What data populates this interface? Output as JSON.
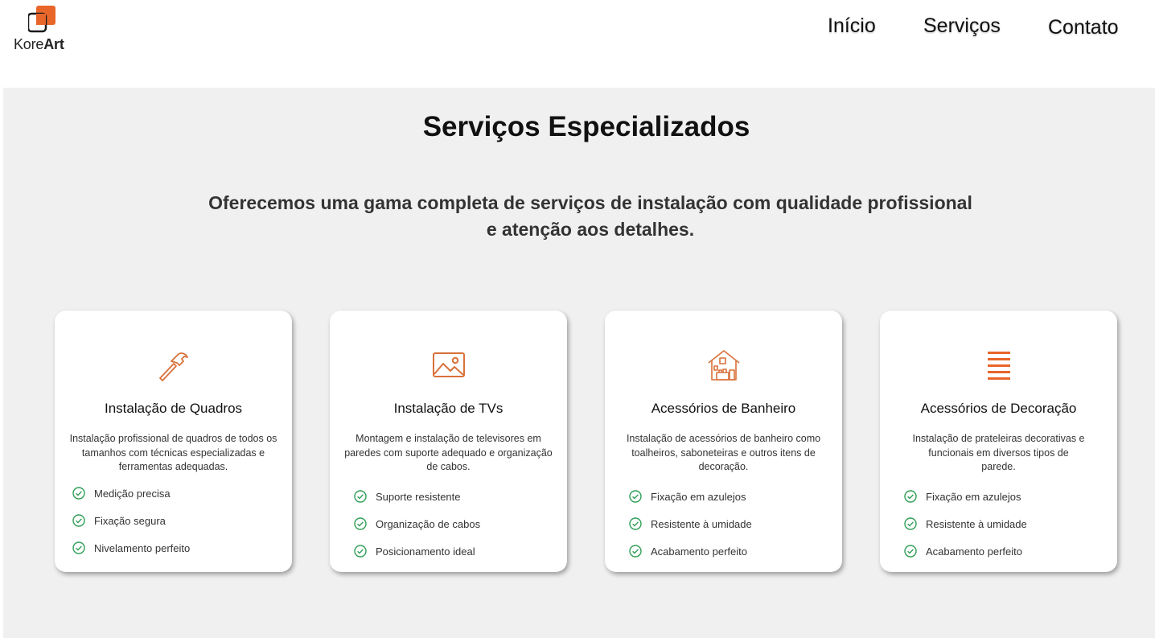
{
  "brand": {
    "name_regular": "Kore",
    "name_bold": "Art",
    "accent_color": "#e8662a"
  },
  "nav": {
    "items": [
      "Início",
      "Serviços",
      "Contato"
    ]
  },
  "services_section": {
    "title": "Serviços Especializados",
    "subtitle_line1": "Oferecemos uma gama completa de serviços de instalação com qualidade profissional",
    "subtitle_line2": "e atenção aos detalhes.",
    "cards": [
      {
        "icon": "hammer-icon",
        "title": "Instalação de Quadros",
        "description": "Instalação profissional de quadros de todos os tamanhos com técnicas especializadas e ferramentas adequadas.",
        "features": [
          "Medição precisa",
          "Fixação segura",
          "Nivelamento perfeito"
        ]
      },
      {
        "icon": "image-icon",
        "title": "Instalação de TVs",
        "description": "Montagem e instalação de televisores em paredes com suporte adequado e organização de cabos.",
        "features": [
          "Suporte resistente",
          "Organização de cabos",
          "Posicionamento ideal"
        ]
      },
      {
        "icon": "house-icon",
        "title": "Acessórios de Banheiro",
        "description": "Instalação de acessórios de banheiro como toalheiros, saboneteiras e outros itens de decoração.",
        "features": [
          "Fixação em azulejos",
          "Resistente à umidade",
          "Acabamento perfeito"
        ]
      },
      {
        "icon": "shelves-icon",
        "title": "Acessórios de Decoração",
        "description": "Instalação de prateleiras decorativas e funcionais em diversos tipos de parede.",
        "features": [
          "Fixação em azulejos",
          "Resistente à umidade",
          "Acabamento perfeito"
        ]
      }
    ]
  },
  "colors": {
    "icon": "#d9713a",
    "check": "#2f9e56",
    "section_bg": "#f0f0f0"
  }
}
